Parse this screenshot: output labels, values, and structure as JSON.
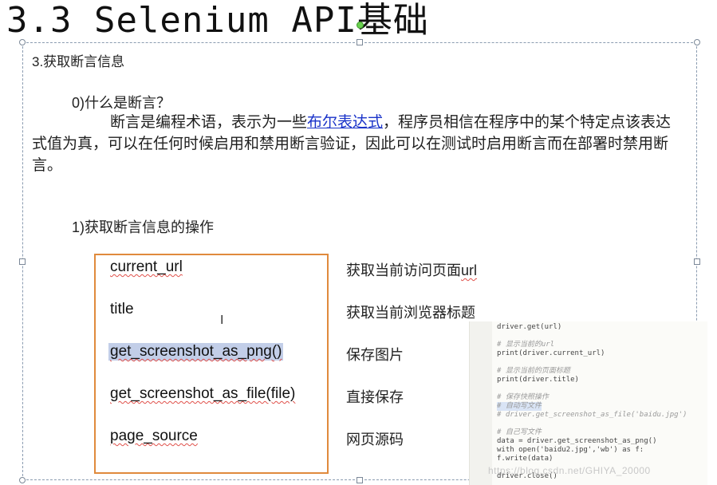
{
  "slide": {
    "title": "3.3 Selenium API基础",
    "section_heading": "3.获取断言信息",
    "question": "0)什么是断言？",
    "paragraph_before_link": "断言是编程术语，表示为一些",
    "paragraph_link": "布尔表达式",
    "paragraph_after_link": "，程序员相信在程序中的某个特定点该表达式值为真，可以在任何时候启用和禁用断言验证，因此可以在测试时启用断言而在部署时禁用断言。",
    "subheading": "1)获取断言信息的操作"
  },
  "methods": [
    {
      "name": "current_url",
      "desc_prefix": "获取当前访问页面",
      "desc_suffix": "url"
    },
    {
      "name": "title",
      "desc_prefix": "获取当前浏览器标题",
      "desc_suffix": ""
    },
    {
      "name": "get_screenshot_as_png()",
      "desc_prefix": "保存图片",
      "desc_suffix": ""
    },
    {
      "name": "get_screenshot_as_file(file)",
      "desc_prefix": "直接保存",
      "desc_suffix": ""
    },
    {
      "name": "page_source",
      "desc_prefix": "网页源码",
      "desc_suffix": ""
    }
  ],
  "code_snippet": {
    "lines": [
      "driver.get(url)",
      "",
      "# 显示当前的url",
      "print(driver.current_url)",
      "",
      "# 显示当前的页面标题",
      "print(driver.title)",
      "",
      "# 保存快照操作",
      "# 自动写文件",
      "# driver.get_screenshot_as_file('baidu.jpg')",
      "",
      "# 自己写文件",
      "data = driver.get_screenshot_as_png()",
      "with open('baidu2.jpg','wb') as f:",
      "    f.write(data)",
      "",
      "driver.close()"
    ]
  },
  "watermark": "https://blog.csdn.net/GHIYA_20000"
}
